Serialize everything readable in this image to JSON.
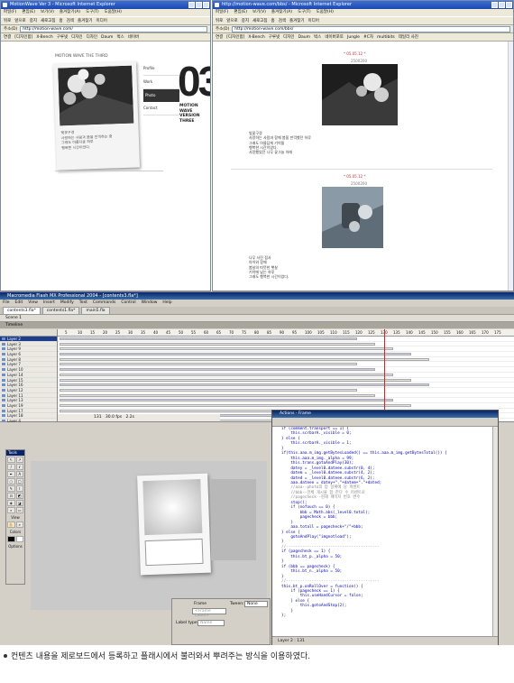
{
  "ie_left": {
    "title": "MotionWave Ver 3 - Microsoft Internet Explorer",
    "menu": [
      "파일(F)",
      "편집(E)",
      "보기(V)",
      "즐겨찾기(A)",
      "도구(T)",
      "도움말(H)"
    ],
    "toolbar": [
      "뒤로",
      "앞으로",
      "중지",
      "새로고침",
      "홈",
      "검색",
      "즐겨찾기",
      "미디어"
    ],
    "address_label": "주소(D)",
    "address": "http://motion-wave.com/",
    "links": [
      "연결",
      "[디자인합]",
      "X-Bench",
      "구루넷",
      "디자인",
      "디자인",
      "Daum",
      "벅스",
      "네이버"
    ],
    "site": {
      "heading": "MOTION WAVE THE THIRD",
      "menu": [
        "Profile",
        "Work",
        "Photo",
        "Contact"
      ],
      "big_number": "03",
      "subtitle_line1": "MOTION WAVE",
      "subtitle_line2": "VERSION THREE",
      "caption_lines": [
        "벚꽃구경",
        "사랑하는 사람과 봄을 만끽하는 중",
        "그래도 아름다운 하루",
        "행복한 시간이었다."
      ]
    }
  },
  "ie_right": {
    "title": "http://motion-wave.com/bbs/ - Microsoft Internet Explorer",
    "menu": [
      "파일(F)",
      "편집(E)",
      "보기(V)",
      "즐겨찾기(A)",
      "도구(T)",
      "도움말(H)"
    ],
    "toolbar": [
      "뒤로",
      "앞으로",
      "중지",
      "새로고침",
      "홈",
      "검색",
      "즐겨찾기",
      "미디어"
    ],
    "address_label": "주소(D)",
    "address": "http://motion-wave.com/bbs/",
    "links": [
      "연결",
      "[디자인합]",
      "X-Bench",
      "구루넷",
      "디자인",
      "Daum",
      "벅스",
      "네이버포토",
      "Jungle",
      "#C자",
      "multibits",
      "데일리 사진"
    ],
    "posts": [
      {
        "date": "* 05.05.12 *",
        "size": "250X200",
        "text": [
          "벚꽃구경",
          "사랑하는 사람과 함께 봄을 만끽했던 하루",
          "그래도 아름답게 기억될",
          "행복한 시간이었다.",
          "사랑했었던 나무 꽃그늘 아래"
        ]
      },
      {
        "date": "* 05.05.12 *",
        "size": "250X200",
        "text": [
          "나무 사진 접사",
          "아이와 함께",
          "봄날의 따뜻한 햇살",
          "기억에 남는 하루",
          "그래도 행복한 시간이었다."
        ]
      }
    ]
  },
  "flash": {
    "title": "Macromedia Flash MX Professional 2004 - [contents3.fla*]",
    "menu": [
      "File",
      "Edit",
      "View",
      "Insert",
      "Modify",
      "Text",
      "Commands",
      "Control",
      "Window",
      "Help"
    ],
    "tabs": [
      "contents3.fla*",
      "contents1.fla*",
      "main5.fla"
    ],
    "scene": "Scene 1",
    "timeline_label": "Timeline",
    "layers": [
      "Layer 2",
      "Layer 3",
      "Layer 9",
      "Layer 6",
      "Layer 8",
      "Layer 7",
      "Layer 10",
      "Layer 14",
      "Layer 15",
      "Layer 16",
      "Layer 12",
      "Layer 11",
      "Layer 13",
      "Layer 19",
      "Layer 17",
      "Layer 18",
      "Layer 4",
      "Layer 1"
    ],
    "ruler": [
      "5",
      "10",
      "15",
      "20",
      "25",
      "30",
      "35",
      "40",
      "45",
      "50",
      "55",
      "60",
      "65",
      "70",
      "75",
      "80",
      "85",
      "90",
      "95",
      "100",
      "105",
      "110",
      "115",
      "120",
      "125",
      "130",
      "135",
      "140",
      "145",
      "150",
      "155",
      "160",
      "165",
      "170",
      "175"
    ],
    "frame_info": [
      "131",
      "30.0 fps",
      "2.2s"
    ],
    "tools_label": "Tools",
    "view_label": "View",
    "colors_label": "Colors",
    "options_label": "Options",
    "props": {
      "frame": "Frame",
      "frame_label": "<Frame Label>",
      "tween": "Tween:",
      "tween_value": "None",
      "label_type": "Label type:",
      "label_type_value": "Name"
    },
    "actions_title": "Actions - Frame",
    "actions_status": "Layer 2 : 131",
    "code": [
      "if (comment.transport == 1) {",
      "    this.scrbarA._visible = 0;",
      "} else {",
      "    this.scrbarA._visible = 1;",
      "}",
      "if(this.aaa.m_img.getBytesLoaded() == this.aaa.m_img.getBytesTotal()) {",
      "    this.aaa.m_img._alpha = 99;",
      "    this.trans.gotoAndPlay(30);",
      "    datey = _level0.dateee.substr(0, 4);",
      "    datem = _level0.dateee.substr(4, 2);",
      "    dated = _level0.dateee.substr(6, 2);",
      "    aaa.dateee = datey+\".\"+datem+\".\"+dated;",
      "    //aaa--photo의 탑 날짜에 당 퍼센트",
      "    //bbb--전체 게시물 합 한다 수 퍼센트로",
      "    //pagecheck--현재 페이지 번호 변수",
      "    stop();",
      "    if (nofouch == 0) {",
      "        bbb = Math.abs(_level0.total);",
      "        pagecheck = bbb;",
      "    }",
      "    aaa.totall = pagecheck+\"/\"+bbb;",
      "} else {",
      "    gotoAndPlay(\"imgnotload\");",
      "}",
      "//----------------------------------------",
      "if (pagecheck == 1) {",
      "    this.bt_p._alpha = 50;",
      "}",
      "if (bbb == pagecheck) {",
      "    this.bt_n._alpha = 50;",
      "}",
      "//----------------------------------------",
      "this.bt_p.onRollOver = function() {",
      "    if (pagecheck == 1) {",
      "        this.useHandCursor = false;",
      "    } else {",
      "        this.gotoAndStop(2);",
      "    }",
      "};"
    ]
  },
  "caption": "컨텐츠 내용을 제로보드에서 등록하고 플래시에서 불러와서 뿌려주는 방식을 이용하였다."
}
